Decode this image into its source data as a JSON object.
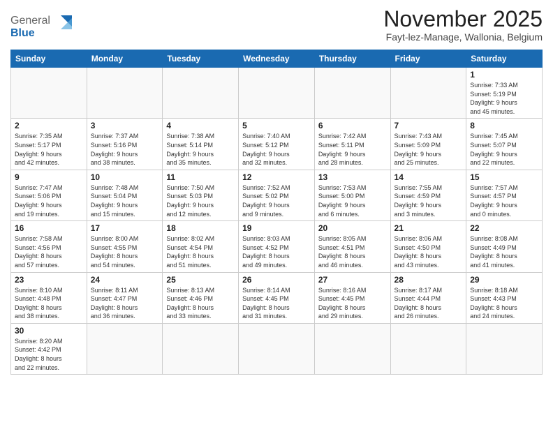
{
  "logo": {
    "text_general": "General",
    "text_blue": "Blue"
  },
  "header": {
    "title": "November 2025",
    "subtitle": "Fayt-lez-Manage, Wallonia, Belgium"
  },
  "weekdays": [
    "Sunday",
    "Monday",
    "Tuesday",
    "Wednesday",
    "Thursday",
    "Friday",
    "Saturday"
  ],
  "weeks": [
    [
      {
        "day": "",
        "info": ""
      },
      {
        "day": "",
        "info": ""
      },
      {
        "day": "",
        "info": ""
      },
      {
        "day": "",
        "info": ""
      },
      {
        "day": "",
        "info": ""
      },
      {
        "day": "",
        "info": ""
      },
      {
        "day": "1",
        "info": "Sunrise: 7:33 AM\nSunset: 5:19 PM\nDaylight: 9 hours\nand 45 minutes."
      }
    ],
    [
      {
        "day": "2",
        "info": "Sunrise: 7:35 AM\nSunset: 5:17 PM\nDaylight: 9 hours\nand 42 minutes."
      },
      {
        "day": "3",
        "info": "Sunrise: 7:37 AM\nSunset: 5:16 PM\nDaylight: 9 hours\nand 38 minutes."
      },
      {
        "day": "4",
        "info": "Sunrise: 7:38 AM\nSunset: 5:14 PM\nDaylight: 9 hours\nand 35 minutes."
      },
      {
        "day": "5",
        "info": "Sunrise: 7:40 AM\nSunset: 5:12 PM\nDaylight: 9 hours\nand 32 minutes."
      },
      {
        "day": "6",
        "info": "Sunrise: 7:42 AM\nSunset: 5:11 PM\nDaylight: 9 hours\nand 28 minutes."
      },
      {
        "day": "7",
        "info": "Sunrise: 7:43 AM\nSunset: 5:09 PM\nDaylight: 9 hours\nand 25 minutes."
      },
      {
        "day": "8",
        "info": "Sunrise: 7:45 AM\nSunset: 5:07 PM\nDaylight: 9 hours\nand 22 minutes."
      }
    ],
    [
      {
        "day": "9",
        "info": "Sunrise: 7:47 AM\nSunset: 5:06 PM\nDaylight: 9 hours\nand 19 minutes."
      },
      {
        "day": "10",
        "info": "Sunrise: 7:48 AM\nSunset: 5:04 PM\nDaylight: 9 hours\nand 15 minutes."
      },
      {
        "day": "11",
        "info": "Sunrise: 7:50 AM\nSunset: 5:03 PM\nDaylight: 9 hours\nand 12 minutes."
      },
      {
        "day": "12",
        "info": "Sunrise: 7:52 AM\nSunset: 5:02 PM\nDaylight: 9 hours\nand 9 minutes."
      },
      {
        "day": "13",
        "info": "Sunrise: 7:53 AM\nSunset: 5:00 PM\nDaylight: 9 hours\nand 6 minutes."
      },
      {
        "day": "14",
        "info": "Sunrise: 7:55 AM\nSunset: 4:59 PM\nDaylight: 9 hours\nand 3 minutes."
      },
      {
        "day": "15",
        "info": "Sunrise: 7:57 AM\nSunset: 4:57 PM\nDaylight: 9 hours\nand 0 minutes."
      }
    ],
    [
      {
        "day": "16",
        "info": "Sunrise: 7:58 AM\nSunset: 4:56 PM\nDaylight: 8 hours\nand 57 minutes."
      },
      {
        "day": "17",
        "info": "Sunrise: 8:00 AM\nSunset: 4:55 PM\nDaylight: 8 hours\nand 54 minutes."
      },
      {
        "day": "18",
        "info": "Sunrise: 8:02 AM\nSunset: 4:54 PM\nDaylight: 8 hours\nand 51 minutes."
      },
      {
        "day": "19",
        "info": "Sunrise: 8:03 AM\nSunset: 4:52 PM\nDaylight: 8 hours\nand 49 minutes."
      },
      {
        "day": "20",
        "info": "Sunrise: 8:05 AM\nSunset: 4:51 PM\nDaylight: 8 hours\nand 46 minutes."
      },
      {
        "day": "21",
        "info": "Sunrise: 8:06 AM\nSunset: 4:50 PM\nDaylight: 8 hours\nand 43 minutes."
      },
      {
        "day": "22",
        "info": "Sunrise: 8:08 AM\nSunset: 4:49 PM\nDaylight: 8 hours\nand 41 minutes."
      }
    ],
    [
      {
        "day": "23",
        "info": "Sunrise: 8:10 AM\nSunset: 4:48 PM\nDaylight: 8 hours\nand 38 minutes."
      },
      {
        "day": "24",
        "info": "Sunrise: 8:11 AM\nSunset: 4:47 PM\nDaylight: 8 hours\nand 36 minutes."
      },
      {
        "day": "25",
        "info": "Sunrise: 8:13 AM\nSunset: 4:46 PM\nDaylight: 8 hours\nand 33 minutes."
      },
      {
        "day": "26",
        "info": "Sunrise: 8:14 AM\nSunset: 4:45 PM\nDaylight: 8 hours\nand 31 minutes."
      },
      {
        "day": "27",
        "info": "Sunrise: 8:16 AM\nSunset: 4:45 PM\nDaylight: 8 hours\nand 29 minutes."
      },
      {
        "day": "28",
        "info": "Sunrise: 8:17 AM\nSunset: 4:44 PM\nDaylight: 8 hours\nand 26 minutes."
      },
      {
        "day": "29",
        "info": "Sunrise: 8:18 AM\nSunset: 4:43 PM\nDaylight: 8 hours\nand 24 minutes."
      }
    ],
    [
      {
        "day": "30",
        "info": "Sunrise: 8:20 AM\nSunset: 4:42 PM\nDaylight: 8 hours\nand 22 minutes."
      },
      {
        "day": "",
        "info": ""
      },
      {
        "day": "",
        "info": ""
      },
      {
        "day": "",
        "info": ""
      },
      {
        "day": "",
        "info": ""
      },
      {
        "day": "",
        "info": ""
      },
      {
        "day": "",
        "info": ""
      }
    ]
  ]
}
